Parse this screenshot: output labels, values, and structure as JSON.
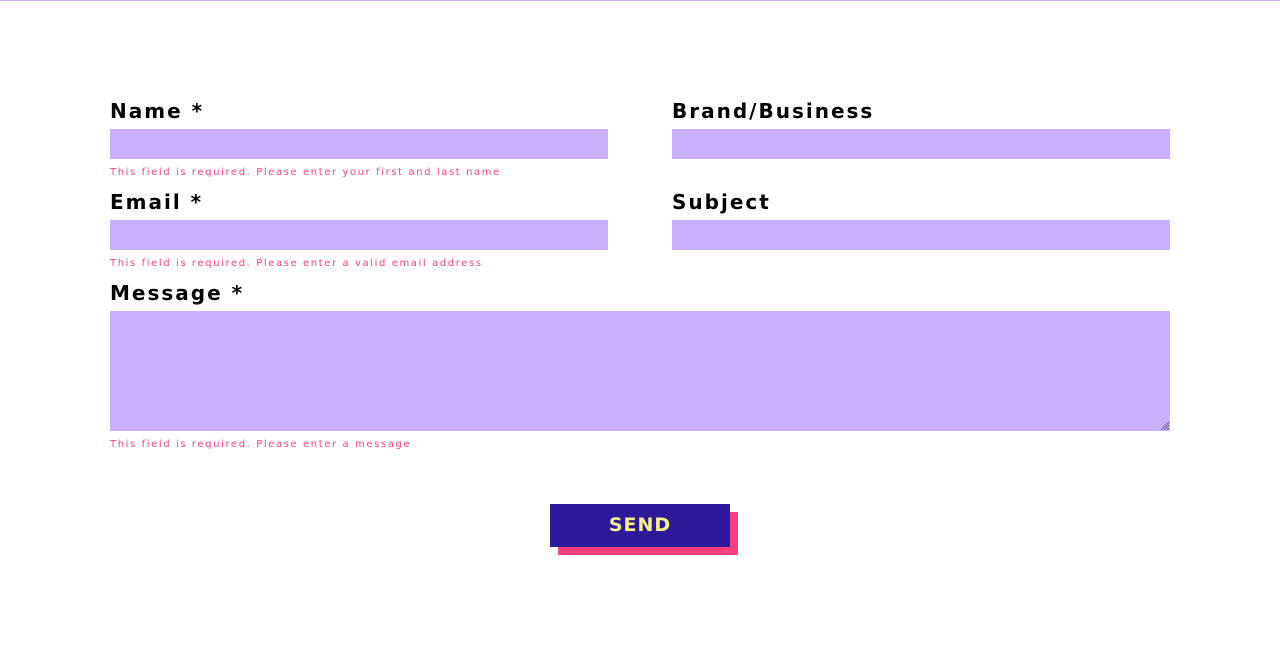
{
  "form": {
    "name": {
      "label": "Name *",
      "value": "",
      "error": "This field is required. Please enter your first and last name"
    },
    "brand": {
      "label": "Brand/Business",
      "value": ""
    },
    "email": {
      "label": "Email *",
      "value": "",
      "error": "This field is required. Please enter a valid email address"
    },
    "subject": {
      "label": "Subject",
      "value": ""
    },
    "message": {
      "label": "Message *",
      "value": "",
      "error": "This field is required. Please enter a message"
    },
    "send_label": "SEND"
  },
  "colors": {
    "field_bg": "#c8b0ff",
    "error_text": "#ff4080",
    "button_bg": "#2c1a9a",
    "button_text": "#f6f08a",
    "button_shadow": "#ff4080"
  }
}
